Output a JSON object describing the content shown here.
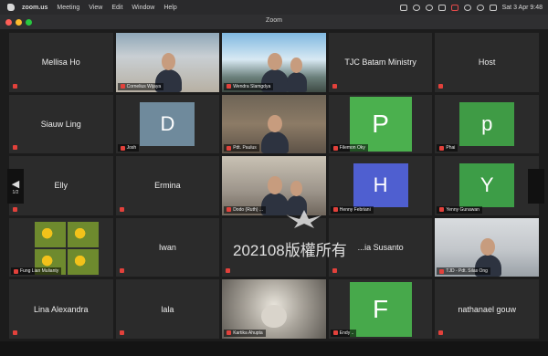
{
  "menubar": {
    "app": "zoom.us",
    "items": [
      "Meeting",
      "View",
      "Edit",
      "Window",
      "Help"
    ],
    "clock": "Sat 3 Apr  9:48"
  },
  "window": {
    "title": "Zoom"
  },
  "nav": {
    "left_label": "1/2"
  },
  "tiles": [
    {
      "type": "name",
      "name": "Mellisa Ho"
    },
    {
      "type": "video",
      "scene": "office",
      "tag": "Cornelius Wijaya"
    },
    {
      "type": "video",
      "scene": "falls",
      "tag": "Wendra Slamgdya"
    },
    {
      "type": "name",
      "name": "TJC Batam Ministry"
    },
    {
      "type": "name",
      "name": "Host"
    },
    {
      "type": "name",
      "name": "Siauw Ling"
    },
    {
      "type": "avatar",
      "letter": "D",
      "color": "#6f8a9c",
      "tag": "Josh"
    },
    {
      "type": "video",
      "scene": "room",
      "tag": "Pdt. Paulus",
      "active": true
    },
    {
      "type": "avatar",
      "letter": "P",
      "color": "#4bb04e",
      "tag": "Filemon Oky",
      "big": true
    },
    {
      "type": "avatar",
      "letter": "p",
      "color": "#3f9b45",
      "tag": "Phai"
    },
    {
      "type": "name",
      "name": "Elly"
    },
    {
      "type": "name",
      "name": "Ermina"
    },
    {
      "type": "video",
      "scene": "family",
      "tag": "Dodo (Ruth) ..."
    },
    {
      "type": "avatar",
      "letter": "H",
      "color": "#4f5fd0",
      "tag": "Henny Febriani"
    },
    {
      "type": "avatar",
      "letter": "Y",
      "color": "#3d9d47",
      "tag": "Yenny Gunawan"
    },
    {
      "type": "video",
      "scene": "flowers",
      "tag": "Fung Lian Mulianty"
    },
    {
      "type": "name",
      "name": "Iwan"
    },
    {
      "type": "name",
      "name": ""
    },
    {
      "type": "name",
      "name": "...ia Susanto"
    },
    {
      "type": "video",
      "scene": "office2",
      "tag": "TJD - Pdt. Silas Ong"
    },
    {
      "type": "name",
      "name": "Lina Alexandra"
    },
    {
      "type": "name",
      "name": "lala"
    },
    {
      "type": "video",
      "scene": "stone",
      "tag": "Kartika Ahupta"
    },
    {
      "type": "avatar",
      "letter": "F",
      "color": "#47a94b",
      "tag": "Endy ..",
      "big": true
    },
    {
      "type": "name",
      "name": "nathanael gouw"
    }
  ],
  "watermark": "202108版權所有"
}
